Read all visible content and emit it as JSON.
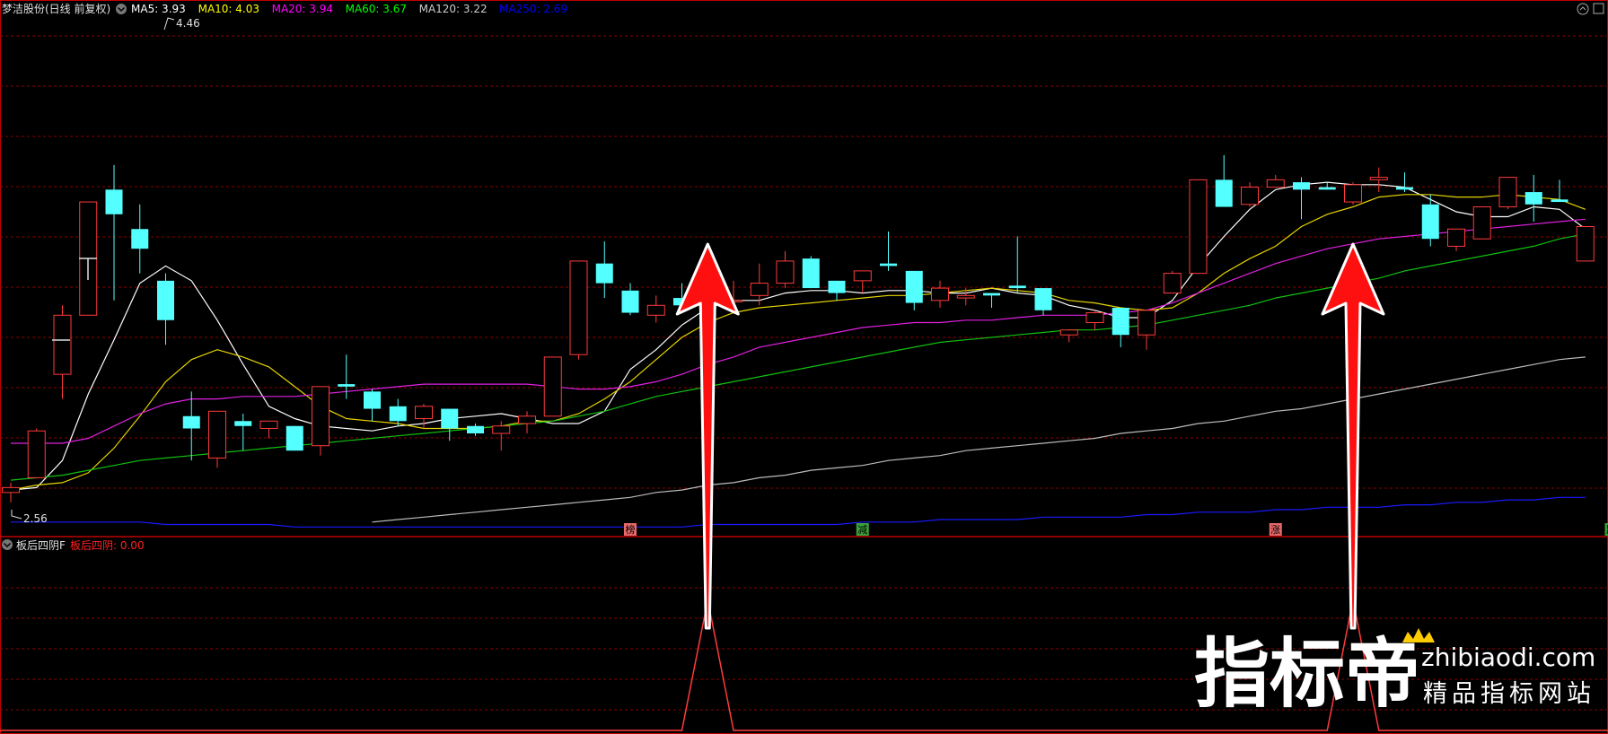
{
  "header": {
    "title": "梦洁股份(日线 前复权)",
    "ma_items": [
      {
        "label": "MA5: 3.93",
        "color": "#ffffff"
      },
      {
        "label": "MA10: 4.03",
        "color": "#ffff00"
      },
      {
        "label": "MA20: 3.94",
        "color": "#ff00ff"
      },
      {
        "label": "MA60: 3.67",
        "color": "#00ff00"
      },
      {
        "label": "MA120: 3.22",
        "color": "#cccccc"
      },
      {
        "label": "MA250: 2.69",
        "color": "#0000ff"
      }
    ]
  },
  "sub_panel": {
    "name": "板后四阴F",
    "value_label": "板后四阴: 0.00",
    "value_color": "#ff2020"
  },
  "price_annotations": {
    "high": "4.46",
    "low": "2.56"
  },
  "event_markers": [
    {
      "label": "榜",
      "candle": 24,
      "bg": "#e86a6a"
    },
    {
      "label": "减",
      "candle": 33,
      "bg": "#3aa23a"
    },
    {
      "label": "涨",
      "candle": 49,
      "bg": "#e86a6a"
    },
    {
      "label": "跌",
      "candle": 62,
      "bg": "#3aa23a"
    }
  ],
  "watermark": {
    "big": "指标帝",
    "domain": "zhibiaodi.com",
    "tagline": "精品指标网站"
  },
  "colors": {
    "up": "#ff3b3b",
    "down": "#54ffff",
    "grid": "#8b0000",
    "border": "#c00000",
    "arrow": "#ff1010"
  },
  "chart_data": {
    "type": "candlestick",
    "y_range": [
      2.45,
      4.52
    ],
    "candles": [
      [
        2.6,
        2.64,
        2.56,
        2.62
      ],
      [
        2.66,
        2.86,
        2.66,
        2.85
      ],
      [
        3.08,
        3.36,
        2.98,
        3.32
      ],
      [
        3.32,
        3.76,
        3.32,
        3.78
      ],
      [
        3.83,
        3.93,
        3.38,
        3.73
      ],
      [
        3.67,
        3.77,
        3.49,
        3.59
      ],
      [
        3.46,
        3.49,
        3.2,
        3.3
      ],
      [
        2.91,
        3.01,
        2.73,
        2.86
      ],
      [
        2.74,
        2.92,
        2.7,
        2.93
      ],
      [
        2.89,
        2.92,
        2.77,
        2.87
      ],
      [
        2.86,
        2.86,
        2.82,
        2.89
      ],
      [
        2.87,
        2.87,
        2.78,
        2.77
      ],
      [
        2.79,
        3.02,
        2.75,
        3.03
      ],
      [
        3.04,
        3.16,
        2.98,
        3.03
      ],
      [
        3.01,
        3.02,
        2.89,
        2.94
      ],
      [
        2.95,
        2.98,
        2.87,
        2.89
      ],
      [
        2.9,
        2.96,
        2.86,
        2.95
      ],
      [
        2.94,
        2.94,
        2.81,
        2.86
      ],
      [
        2.87,
        2.88,
        2.83,
        2.84
      ],
      [
        2.84,
        2.89,
        2.77,
        2.87
      ],
      [
        2.88,
        2.93,
        2.84,
        2.91
      ],
      [
        2.91,
        3.15,
        2.91,
        3.15
      ],
      [
        3.16,
        3.53,
        3.14,
        3.54
      ],
      [
        3.53,
        3.62,
        3.39,
        3.45
      ],
      [
        3.42,
        3.45,
        3.32,
        3.33
      ],
      [
        3.32,
        3.4,
        3.29,
        3.36
      ],
      [
        3.39,
        3.45,
        3.33,
        3.36
      ],
      [
        3.37,
        3.5,
        3.31,
        3.35
      ],
      [
        3.38,
        3.46,
        3.37,
        3.38
      ],
      [
        3.4,
        3.53,
        3.36,
        3.45
      ],
      [
        3.45,
        3.58,
        3.43,
        3.54
      ],
      [
        3.55,
        3.56,
        3.43,
        3.43
      ],
      [
        3.46,
        3.46,
        3.38,
        3.41
      ],
      [
        3.46,
        3.5,
        3.41,
        3.5
      ],
      [
        3.53,
        3.66,
        3.5,
        3.52
      ],
      [
        3.5,
        3.5,
        3.34,
        3.37
      ],
      [
        3.38,
        3.46,
        3.35,
        3.43
      ],
      [
        3.39,
        3.43,
        3.36,
        3.4
      ],
      [
        3.41,
        3.41,
        3.35,
        3.4
      ],
      [
        3.44,
        3.64,
        3.41,
        3.43
      ],
      [
        3.43,
        3.43,
        3.32,
        3.34
      ],
      [
        3.24,
        3.24,
        3.21,
        3.26
      ],
      [
        3.29,
        3.34,
        3.26,
        3.33
      ],
      [
        3.35,
        3.35,
        3.19,
        3.24
      ],
      [
        3.24,
        3.34,
        3.18,
        3.34
      ],
      [
        3.41,
        3.5,
        3.41,
        3.49
      ],
      [
        3.49,
        3.87,
        3.49,
        3.87
      ],
      [
        3.87,
        3.97,
        3.76,
        3.76
      ],
      [
        3.77,
        3.86,
        3.76,
        3.84
      ],
      [
        3.84,
        3.89,
        3.84,
        3.87
      ],
      [
        3.86,
        3.88,
        3.71,
        3.83
      ],
      [
        3.84,
        3.86,
        3.85,
        3.83
      ],
      [
        3.78,
        3.86,
        3.77,
        3.85
      ],
      [
        3.87,
        3.92,
        3.82,
        3.88
      ],
      [
        3.84,
        3.9,
        3.82,
        3.83
      ],
      [
        3.77,
        3.81,
        3.6,
        3.63
      ],
      [
        3.6,
        3.6,
        3.58,
        3.67
      ],
      [
        3.63,
        3.68,
        3.63,
        3.76
      ],
      [
        3.76,
        3.8,
        3.75,
        3.88
      ],
      [
        3.82,
        3.89,
        3.7,
        3.77
      ],
      [
        3.79,
        3.87,
        3.79,
        3.78
      ],
      [
        3.54,
        3.54,
        3.54,
        3.68
      ]
    ],
    "ma": {
      "MA5": [
        2.61,
        2.62,
        2.73,
        3.0,
        3.22,
        3.45,
        3.52,
        3.46,
        3.3,
        3.12,
        2.95,
        2.9,
        2.87,
        2.86,
        2.85,
        2.87,
        2.88,
        2.9,
        2.91,
        2.92,
        2.9,
        2.88,
        2.88,
        2.93,
        3.1,
        3.18,
        3.28,
        3.35,
        3.38,
        3.38,
        3.41,
        3.42,
        3.42,
        3.41,
        3.42,
        3.42,
        3.41,
        3.41,
        3.43,
        3.41,
        3.4,
        3.36,
        3.34,
        3.31,
        3.31,
        3.38,
        3.52,
        3.64,
        3.75,
        3.83,
        3.85,
        3.86,
        3.85,
        3.85,
        3.84,
        3.79,
        3.74,
        3.72,
        3.72,
        3.76,
        3.75,
        3.67
      ],
      "MA10": [
        2.61,
        2.63,
        2.64,
        2.68,
        2.78,
        2.91,
        3.05,
        3.14,
        3.18,
        3.15,
        3.11,
        3.03,
        2.95,
        2.9,
        2.89,
        2.88,
        2.86,
        2.86,
        2.86,
        2.87,
        2.89,
        2.89,
        2.92,
        2.98,
        3.05,
        3.14,
        3.23,
        3.29,
        3.33,
        3.35,
        3.36,
        3.37,
        3.38,
        3.39,
        3.4,
        3.4,
        3.41,
        3.42,
        3.43,
        3.42,
        3.41,
        3.38,
        3.37,
        3.35,
        3.34,
        3.35,
        3.41,
        3.49,
        3.55,
        3.6,
        3.68,
        3.73,
        3.76,
        3.8,
        3.81,
        3.81,
        3.8,
        3.8,
        3.81,
        3.8,
        3.79,
        3.75
      ],
      "MA20": [
        2.8,
        2.8,
        2.8,
        2.82,
        2.87,
        2.92,
        2.96,
        2.98,
        2.98,
        2.99,
        2.99,
        2.99,
        3.0,
        3.01,
        3.02,
        3.03,
        3.04,
        3.04,
        3.04,
        3.04,
        3.04,
        3.03,
        3.02,
        3.02,
        3.03,
        3.05,
        3.08,
        3.12,
        3.15,
        3.19,
        3.21,
        3.23,
        3.25,
        3.27,
        3.28,
        3.29,
        3.29,
        3.3,
        3.3,
        3.31,
        3.32,
        3.32,
        3.32,
        3.33,
        3.34,
        3.37,
        3.41,
        3.45,
        3.49,
        3.53,
        3.56,
        3.59,
        3.61,
        3.63,
        3.64,
        3.65,
        3.66,
        3.67,
        3.68,
        3.69,
        3.7,
        3.71
      ],
      "MA60": [
        2.65,
        2.66,
        2.67,
        2.69,
        2.71,
        2.73,
        2.74,
        2.75,
        2.76,
        2.77,
        2.78,
        2.79,
        2.8,
        2.81,
        2.82,
        2.83,
        2.84,
        2.85,
        2.86,
        2.87,
        2.88,
        2.89,
        2.91,
        2.93,
        2.96,
        2.99,
        3.01,
        3.03,
        3.05,
        3.07,
        3.09,
        3.11,
        3.13,
        3.15,
        3.17,
        3.19,
        3.21,
        3.22,
        3.23,
        3.24,
        3.25,
        3.26,
        3.26,
        3.27,
        3.28,
        3.3,
        3.32,
        3.34,
        3.36,
        3.39,
        3.41,
        3.43,
        3.45,
        3.47,
        3.5,
        3.52,
        3.54,
        3.56,
        3.58,
        3.6,
        3.63,
        3.65
      ],
      "MA120": [
        null,
        null,
        null,
        null,
        null,
        null,
        null,
        null,
        null,
        null,
        null,
        null,
        null,
        null,
        2.48,
        2.49,
        2.5,
        2.51,
        2.52,
        2.53,
        2.54,
        2.55,
        2.56,
        2.57,
        2.58,
        2.6,
        2.61,
        2.63,
        2.64,
        2.66,
        2.67,
        2.69,
        2.7,
        2.71,
        2.73,
        2.74,
        2.75,
        2.77,
        2.78,
        2.79,
        2.8,
        2.81,
        2.82,
        2.84,
        2.85,
        2.86,
        2.88,
        2.89,
        2.91,
        2.93,
        2.94,
        2.96,
        2.98,
        3.0,
        3.02,
        3.04,
        3.06,
        3.08,
        3.1,
        3.12,
        3.14,
        3.15
      ],
      "MA250": [
        2.48,
        2.48,
        2.48,
        2.48,
        2.48,
        2.48,
        2.47,
        2.47,
        2.47,
        2.47,
        2.47,
        2.46,
        2.46,
        2.46,
        2.46,
        2.46,
        2.46,
        2.46,
        2.46,
        2.46,
        2.46,
        2.46,
        2.46,
        2.46,
        2.46,
        2.46,
        2.46,
        2.47,
        2.47,
        2.47,
        2.47,
        2.47,
        2.47,
        2.48,
        2.48,
        2.48,
        2.49,
        2.49,
        2.49,
        2.49,
        2.5,
        2.5,
        2.5,
        2.5,
        2.51,
        2.51,
        2.52,
        2.52,
        2.52,
        2.53,
        2.53,
        2.54,
        2.54,
        2.54,
        2.55,
        2.55,
        2.56,
        2.56,
        2.57,
        2.57,
        2.58,
        2.58
      ]
    },
    "sub_signal": [
      0,
      0,
      0,
      0,
      0,
      0,
      0,
      0,
      0,
      0,
      0,
      0,
      0,
      0,
      0,
      0,
      0,
      0,
      0,
      0,
      0,
      0,
      0,
      0,
      0,
      0,
      0,
      1,
      0,
      0,
      0,
      0,
      0,
      0,
      0,
      0,
      0,
      0,
      0,
      0,
      0,
      0,
      0,
      0,
      0,
      0,
      0,
      0,
      0,
      0,
      0,
      0,
      1,
      0,
      0,
      0,
      0,
      0,
      0,
      0,
      0,
      0
    ],
    "sub_y_range": [
      0,
      1.3
    ],
    "arrows_at_candles": [
      27,
      52
    ]
  }
}
